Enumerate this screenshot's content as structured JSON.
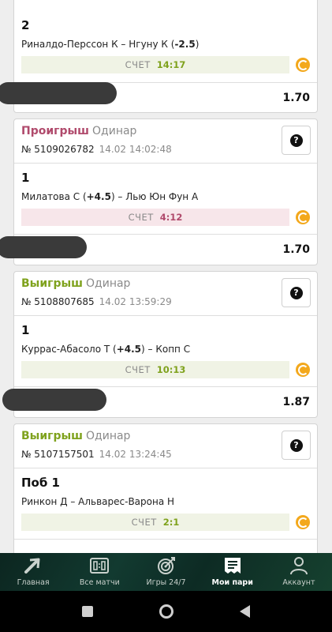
{
  "bets": [
    {
      "status": "",
      "type": "",
      "ticket": "",
      "datetime": "",
      "outcome": "2",
      "match_pre": "Риналдо-Перссон К – Нгуну К (",
      "handicap": "-2.5",
      "match_post": ")",
      "score_label": "СЧЕТ",
      "score": "14:17",
      "result": "win",
      "odds": "1.70"
    },
    {
      "status": "Проигрыш",
      "type": "Одинар",
      "ticket": "№ 5109026782",
      "datetime": "14.02 14:02:48",
      "outcome": "1",
      "match_pre": "Милатова С (",
      "handicap": "+4.5",
      "match_post": ") – Лью Юн Фун А",
      "score_label": "СЧЕТ",
      "score": "4:12",
      "result": "lose",
      "odds": "1.70"
    },
    {
      "status": "Выигрыш",
      "type": "Одинар",
      "ticket": "№ 5108807685",
      "datetime": "14.02 13:59:29",
      "outcome": "1",
      "match_pre": "Куррас-Абасоло Т (",
      "handicap": "+4.5",
      "match_post": ") – Копп С",
      "score_label": "СЧЕТ",
      "score": "10:13",
      "result": "win",
      "odds": "1.87"
    },
    {
      "status": "Выигрыш",
      "type": "Одинар",
      "ticket": "№ 5107157501",
      "datetime": "14.02 13:24:45",
      "outcome": "Поб 1",
      "match_pre": "Ринкон Д – Альварес-Варона Н",
      "handicap": "",
      "match_post": "",
      "score_label": "СЧЕТ",
      "score": "2:1",
      "result": "win",
      "odds": ""
    }
  ],
  "help_glyph": "?",
  "nav": {
    "items": [
      {
        "label": "Главная",
        "icon": "arrow-icon"
      },
      {
        "label": "Все матчи",
        "icon": "scoreboard-icon"
      },
      {
        "label": "Игры 24/7",
        "icon": "target-icon"
      },
      {
        "label": "Мои пари",
        "icon": "receipt-icon"
      },
      {
        "label": "Аккаунт",
        "icon": "user-icon"
      }
    ],
    "active_index": 3
  },
  "colors": {
    "lose": "#b04a6c",
    "win": "#7fa21d",
    "nav_bg": "#0d2b24",
    "coin": "#f3a81c"
  }
}
